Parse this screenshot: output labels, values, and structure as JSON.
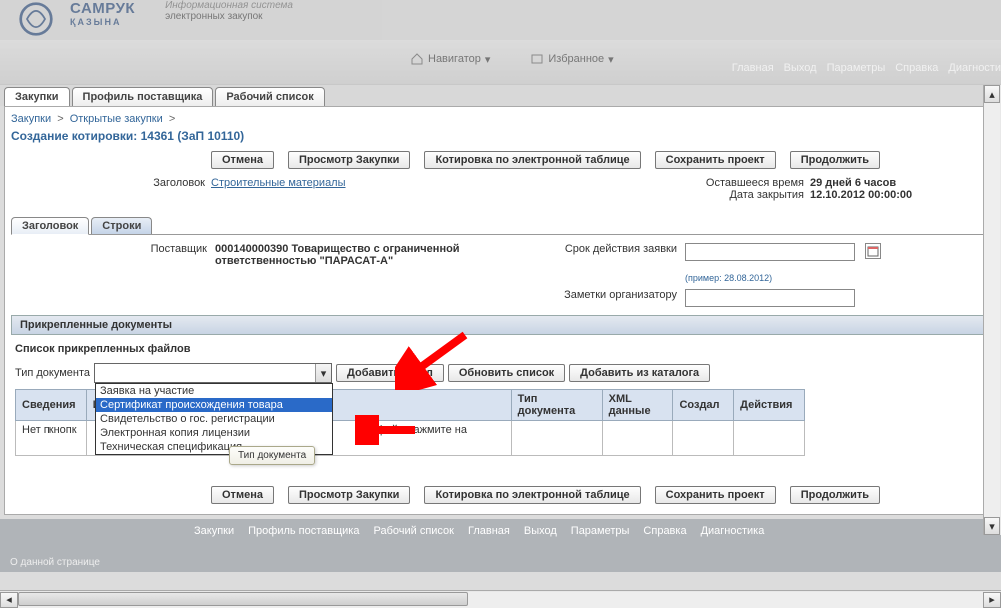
{
  "brand": {
    "name": "САМРУК",
    "sub": "ҚАЗЫНА",
    "sys1": "Информационная система",
    "sys2": "электронных закупок"
  },
  "top_tools": {
    "navigator": "Навигатор",
    "favorites": "Избранное"
  },
  "top_links": {
    "home": "Главная",
    "exit": "Выход",
    "params": "Параметры",
    "help": "Справка",
    "diag": "Диагности"
  },
  "main_tabs": {
    "purchases": "Закупки",
    "supplier_profile": "Профиль поставщика",
    "worklist": "Рабочий список"
  },
  "breadcrumb": {
    "root": "Закупки",
    "open": "Открытые закупки"
  },
  "page_title": "Создание котировки: 14361 (ЗаП 10110)",
  "buttons": {
    "cancel": "Отмена",
    "view": "Просмотр Закупки",
    "spreadsheet": "Котировка по электронной таблице",
    "save_draft": "Сохранить проект",
    "continue": "Продолжить",
    "add_file": "Добавить файл",
    "refresh_list": "Обновить список",
    "add_from_catalog": "Добавить из каталога"
  },
  "meta": {
    "header_label": "Заголовок",
    "header_link": "Строительные материалы",
    "remaining_label": "Оставшееся время",
    "remaining_value": "29 дней 6 часов",
    "close_label": "Дата закрытия",
    "close_value": "12.10.2012 00:00:00"
  },
  "sub_tabs": {
    "header": "Заголовок",
    "lines": "Строки"
  },
  "form": {
    "supplier_label": "Поставщик",
    "supplier_value": "000140000390 Товарищество с ограниченной ответственностью \"ПАРАСАТ-А\"",
    "valid_label": "Срок действия заявки",
    "valid_hint": "(пример: 28.08.2012)",
    "notes_label": "Заметки организатору"
  },
  "attach": {
    "bar": "Прикрепленные документы",
    "list_title": "Список прикрепленных файлов",
    "doc_type_label": "Тип документа",
    "tooltip": "Тип документа"
  },
  "dropdown_options": [
    "Заявка на участие",
    "Сертификат происхождения товара",
    "Свидетельство о гос. регистрации",
    "Электронная копия лицензии",
    "Техническая спецификация"
  ],
  "table": {
    "headers": {
      "c1": "Сведения",
      "c2": "Имя",
      "c3": "Тип документа",
      "c4": "XML данные",
      "c5": "Создал",
      "c6": "Действия"
    },
    "empty_row": {
      "c1": "Нет п",
      "c2a": "кнопк",
      "c2b": "ть файл нажмите на"
    }
  },
  "footer_links": [
    "Закупки",
    "Профиль поставщика",
    "Рабочий список",
    "Главная",
    "Выход",
    "Параметры",
    "Справка",
    "Диагностика"
  ],
  "footer_cp": "О данной странице"
}
